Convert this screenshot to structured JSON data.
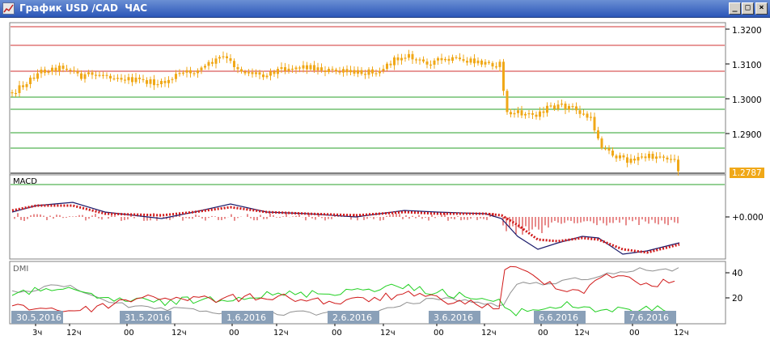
{
  "window": {
    "title": "График USD /CAD  ЧАС",
    "minimize_glyph": "_",
    "maximize_glyph": "□",
    "close_glyph": "×"
  },
  "price_pane": {
    "ticks": [
      "1.3200",
      "1.3100",
      "1.3000",
      "1.2900"
    ],
    "current_price": "1.2787"
  },
  "macd_pane": {
    "label": "MACD",
    "tick": "+0.000"
  },
  "dmi_pane": {
    "label": "DMI",
    "ticks": [
      "40",
      "20"
    ]
  },
  "x_axis": {
    "date_labels": [
      "30.5.2016",
      "31.5.2016",
      "1.6.2016",
      "2.6.2016",
      "3.6.2016",
      "6.6.2016",
      "7.6.2016"
    ],
    "hour_labels": [
      "3ч",
      "12ч",
      "00",
      "12ч",
      "00",
      "12ч",
      "00",
      "12ч",
      "00",
      "12ч",
      "00",
      "12ч",
      "00",
      "12ч"
    ]
  },
  "colors": {
    "candle": "#f0a818",
    "red_level": "#d03030",
    "green_level": "#28a028",
    "macd_line": "#1a1a6a",
    "macd_signal": "#d01818",
    "dmi_adx": "#909090",
    "dmi_plus": "#22d022",
    "dmi_minus": "#d01818",
    "date_badge": "#8aa0b8"
  }
}
